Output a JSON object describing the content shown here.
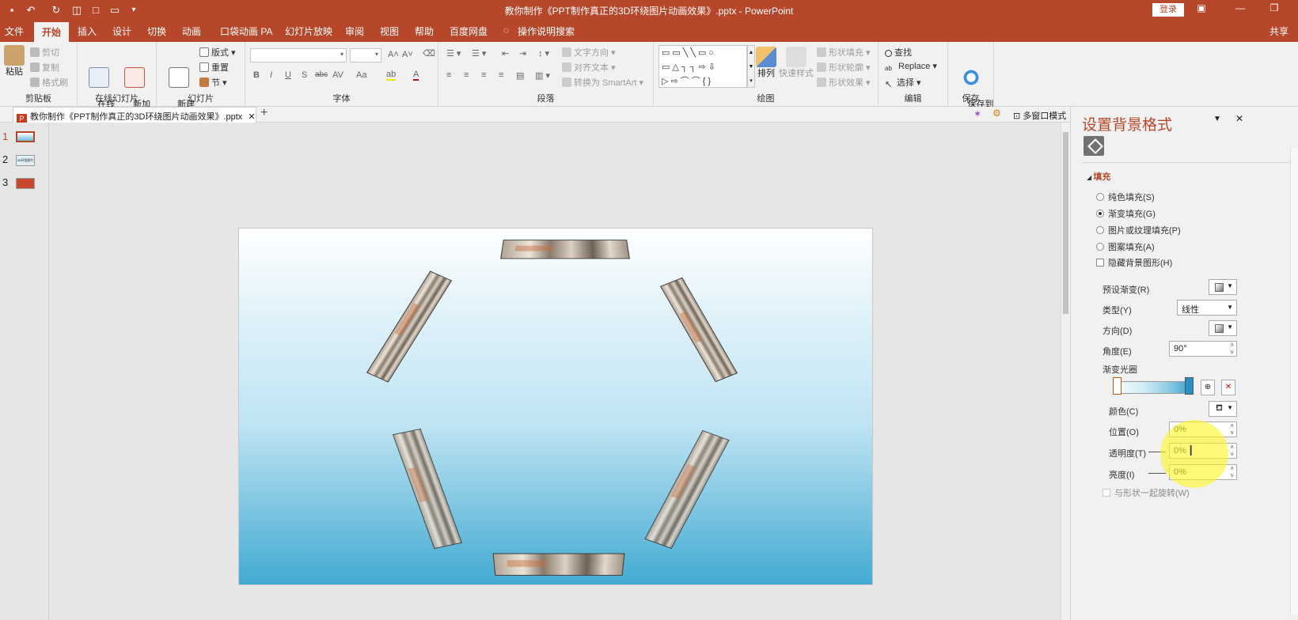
{
  "titlebar": {
    "title": "教你制作《PPT制作真正的3D环绕图片动画效果》.pptx - PowerPoint",
    "login": "登录"
  },
  "tabs": [
    "文件",
    "开始",
    "插入",
    "设计",
    "切换",
    "动画",
    "口袋动画 PA",
    "幻灯片放映",
    "审阅",
    "视图",
    "帮助",
    "百度网盘",
    "操作说明搜索"
  ],
  "share": "共享",
  "ribbon": {
    "clipboard": {
      "label": "剪贴板",
      "paste": "粘贴",
      "cut": "剪切",
      "copy": "复制",
      "format_painter": "格式刷"
    },
    "online": {
      "label": "在线幻灯片",
      "online_slide": "在线\n幻灯片",
      "new_anim": "新加\n动画页"
    },
    "slides": {
      "label": "幻灯片",
      "new_slide": "新建\n幻灯片",
      "layout": "版式",
      "reset": "重置",
      "section": "节"
    },
    "font": {
      "label": "字体",
      "bold": "B",
      "italic": "I",
      "underline": "U",
      "shadow": "S",
      "strike": "abc",
      "spacing": "AV",
      "case": "Aa",
      "color": "A"
    },
    "paragraph": {
      "label": "段落",
      "text_direction": "文字方向",
      "align_text": "对齐文本",
      "smartart": "转换为 SmartArt"
    },
    "drawing": {
      "label": "绘图",
      "arrange": "排列",
      "quick_styles": "快速样式",
      "shape_fill": "形状填充",
      "shape_outline": "形状轮廓",
      "shape_effects": "形状效果"
    },
    "editing": {
      "label": "编辑",
      "find": "查找",
      "replace": "Replace",
      "select": "选择"
    },
    "save": {
      "label": "保存",
      "save_to": "保存到\n百度网盘"
    }
  },
  "doc_tab": {
    "name": "教你制作《PPT制作真正的3D环绕图片动画效果》.pptx",
    "multi_window": "多窗口模式"
  },
  "slides_list": [
    {
      "num": "1"
    },
    {
      "num": "2",
      "thumb_text": "3D环绕图片"
    },
    {
      "num": "3"
    }
  ],
  "panel": {
    "title": "设置背景格式",
    "fill_section": "填充",
    "options": {
      "solid": "纯色填充(S)",
      "gradient": "渐变填充(G)",
      "picture": "图片或纹理填充(P)",
      "pattern": "图案填充(A)",
      "hide_bg": "隐藏背景图形(H)"
    },
    "preset": "预设渐变(R)",
    "type_label": "类型(Y)",
    "type_value": "线性",
    "direction": "方向(D)",
    "angle_label": "角度(E)",
    "angle_value": "90°",
    "stops_label": "渐变光圈",
    "color_label": "颜色(C)",
    "position_label": "位置(O)",
    "position_value": "0%",
    "transparency_label": "透明度(T)",
    "transparency_value": "0%",
    "brightness_label": "亮度(I)",
    "brightness_value": "0%",
    "rotate_with_shape": "与形状一起旋转(W)"
  }
}
